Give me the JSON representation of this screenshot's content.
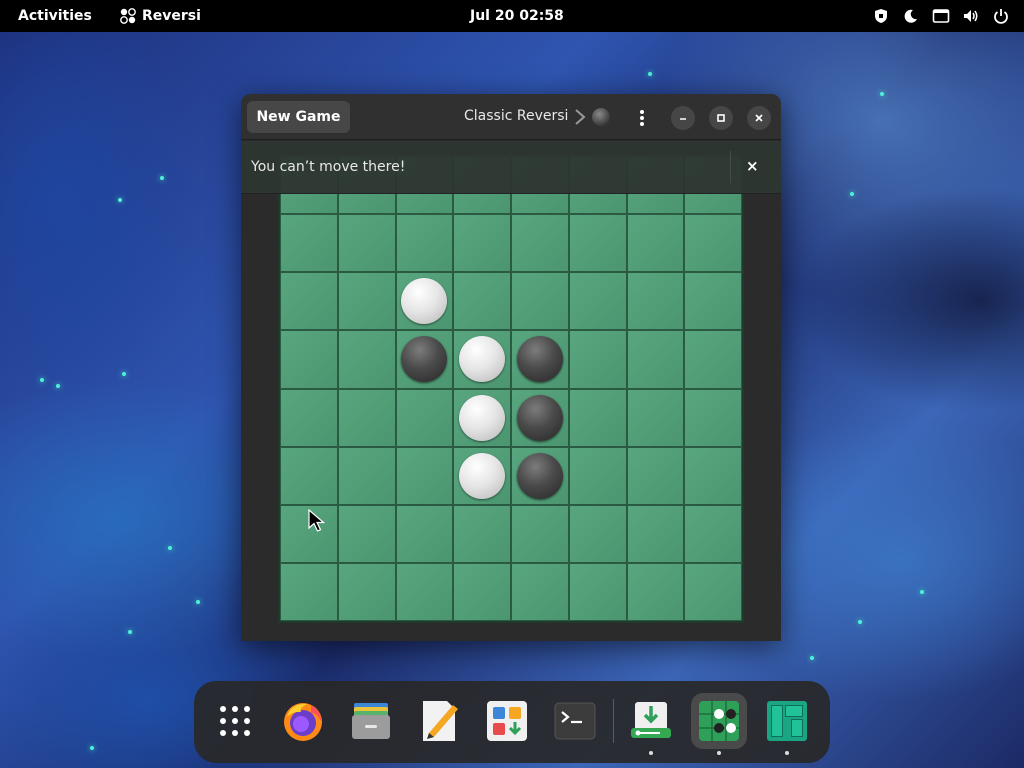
{
  "topbar": {
    "activities": "Activities",
    "app_name": "Reversi",
    "clock": "Jul 20  02:58",
    "tray_icons": [
      "shield-icon",
      "night-mode-icon",
      "screen-share-icon",
      "volume-icon",
      "power-icon"
    ]
  },
  "window": {
    "new_game_label": "New Game",
    "game_title": "Classic Reversi",
    "current_turn": "black",
    "infobar_message": "You can’t move there!",
    "infobar_close": "×",
    "controls": [
      "menu-icon",
      "minimize-icon",
      "maximize-icon",
      "close-icon"
    ]
  },
  "board": {
    "size": 8,
    "colors": {
      "board": "#4f9a75",
      "white": "#ececec",
      "black": "#3a3a3a"
    },
    "rows": [
      [
        "",
        "",
        "",
        "",
        "",
        "",
        "",
        ""
      ],
      [
        "",
        "",
        "",
        "",
        "",
        "",
        "",
        ""
      ],
      [
        "",
        "",
        "W",
        "",
        "",
        "",
        "",
        ""
      ],
      [
        "",
        "",
        "B",
        "W",
        "B",
        "",
        "",
        ""
      ],
      [
        "",
        "",
        "",
        "W",
        "B",
        "",
        "",
        ""
      ],
      [
        "",
        "",
        "",
        "W",
        "B",
        "",
        "",
        ""
      ],
      [
        "",
        "",
        "",
        "",
        "",
        "",
        "",
        ""
      ],
      [
        "",
        "",
        "",
        "",
        "",
        "",
        "",
        ""
      ]
    ]
  },
  "dock": {
    "items": [
      {
        "name": "show-apps",
        "icon": "app-grid-icon",
        "running": false
      },
      {
        "name": "firefox",
        "icon": "firefox-icon",
        "running": false
      },
      {
        "name": "files",
        "icon": "files-icon",
        "running": false
      },
      {
        "name": "text-editor",
        "icon": "text-editor-icon",
        "running": false
      },
      {
        "name": "software",
        "icon": "software-icon",
        "running": false
      },
      {
        "name": "terminal",
        "icon": "terminal-icon",
        "running": false
      },
      {
        "name": "update-manager",
        "icon": "download-icon",
        "running": true
      },
      {
        "name": "reversi",
        "icon": "reversi-icon",
        "running": true,
        "active": true
      },
      {
        "name": "manjaro",
        "icon": "manjaro-icon",
        "running": true
      }
    ]
  }
}
